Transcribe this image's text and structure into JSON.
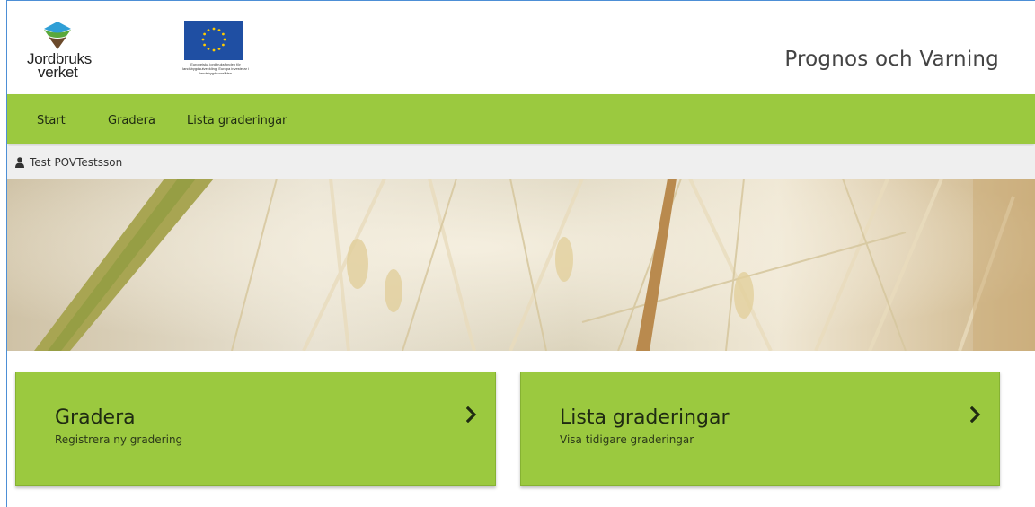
{
  "header": {
    "logo_jv_line1": "Jordbruks",
    "logo_jv_line2": "verket",
    "eu_caption": "Europeiska jordbruksfonden för landsbygdsutveckling: Europa investerar i landsbygdsområden",
    "app_title": "Prognos och Varning"
  },
  "nav": {
    "items": [
      {
        "label": "Start"
      },
      {
        "label": "Gradera"
      },
      {
        "label": "Lista graderingar"
      }
    ]
  },
  "user": {
    "icon": "user-icon",
    "name": "Test POVTestsson"
  },
  "cards": [
    {
      "title": "Gradera",
      "subtitle": "Registrera ny gradering",
      "icon": "chevron-right-icon"
    },
    {
      "title": "Lista graderingar",
      "subtitle": "Visa tidigare graderingar",
      "icon": "chevron-right-icon"
    }
  ],
  "colors": {
    "accent": "#9bc93f",
    "frame_border": "#4d8fd6",
    "eu_blue": "#1f4fa3",
    "eu_star": "#ffcc00"
  }
}
